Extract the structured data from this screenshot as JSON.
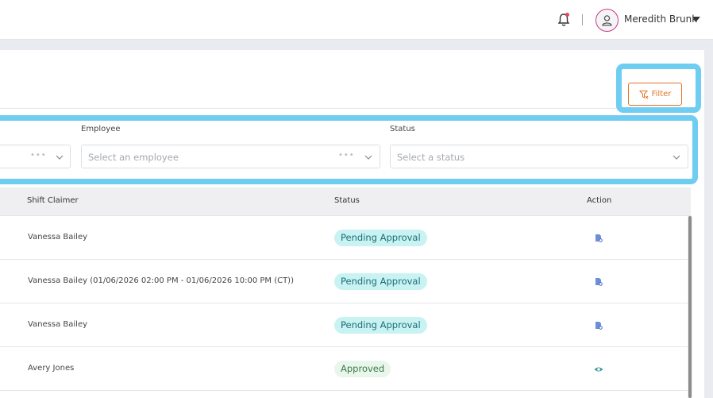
{
  "header": {
    "user_name": "Meredith Brunk",
    "notification_icon": "bell-icon",
    "avatar_icon": "user-icon",
    "menu_icon": "caret-down-icon"
  },
  "toolbar": {
    "filter_label": "Filter",
    "filter_icon": "filter-icon"
  },
  "filters": {
    "employee": {
      "label": "Employee",
      "placeholder": "Select an employee"
    },
    "status": {
      "label": "Status",
      "placeholder": "Select a status"
    }
  },
  "table": {
    "columns": [
      "Shift Claimer",
      "Status",
      "Action"
    ],
    "rows": [
      {
        "claimer": "Vanessa Bailey",
        "status": "Pending Approval",
        "status_kind": "pending",
        "action_icon": "document-search-icon"
      },
      {
        "claimer": "Vanessa Bailey (01/06/2026 02:00 PM - 01/06/2026 10:00 PM (CT))",
        "status": "Pending Approval",
        "status_kind": "pending",
        "action_icon": "document-search-icon"
      },
      {
        "claimer": "Vanessa Bailey",
        "status": "Pending Approval",
        "status_kind": "pending",
        "action_icon": "document-search-icon"
      },
      {
        "claimer": "Avery Jones",
        "status": "Approved",
        "status_kind": "approved",
        "action_icon": "eye-icon"
      }
    ]
  },
  "colors": {
    "accent_orange": "#e47325",
    "highlight": "#6fcdf2",
    "pending_bg": "#c9f2f3",
    "approved_bg": "#e9f6ec"
  }
}
